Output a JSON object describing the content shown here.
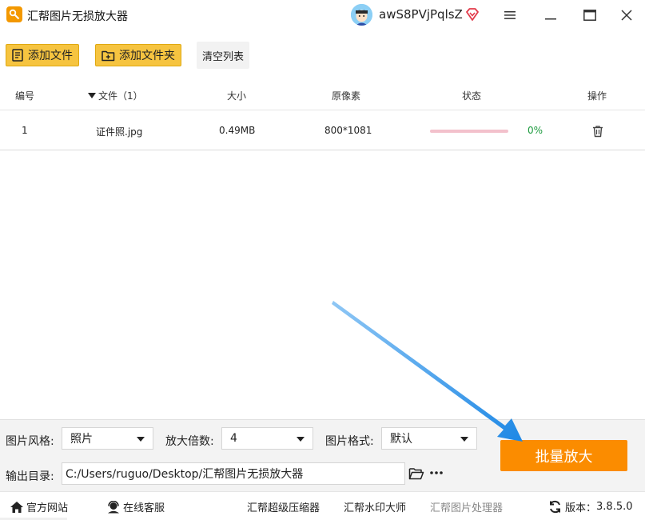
{
  "window": {
    "title": "汇帮图片无损放大器",
    "username": "awS8PVjPqlsZ"
  },
  "toolbar": {
    "add_file": "添加文件",
    "add_folder": "添加文件夹",
    "clear_list": "清空列表"
  },
  "table": {
    "headers": {
      "index": "编号",
      "file": "文件（1）",
      "size": "大小",
      "pixels": "原像素",
      "status": "状态",
      "action": "操作"
    },
    "rows": [
      {
        "index": "1",
        "file": "证件照.jpg",
        "size": "0.49MB",
        "pixels": "800*1081",
        "progress": 0,
        "percent": "0%"
      }
    ]
  },
  "settings": {
    "style_label": "图片风格:",
    "style_value": "照片",
    "scale_label": "放大倍数:",
    "scale_value": "4",
    "format_label": "图片格式:",
    "format_value": "默认",
    "output_label": "输出目录:",
    "output_path": "C:/Users/ruguo/Desktop/汇帮图片无损放大器",
    "more": "···",
    "batch_button": "批量放大"
  },
  "footer": {
    "website": "官方网站",
    "support": "在线客服",
    "compressor": "汇帮超级压缩器",
    "watermark": "汇帮水印大师",
    "processor": "汇帮图片处理器",
    "version_label": "版本：",
    "version": "3.8.5.0"
  },
  "colors": {
    "accent_orange": "#fb8c00",
    "button_yellow": "#f6c440",
    "progress_pink": "#f3c1cc",
    "percent_green": "#1a9a3c",
    "arrow_blue": "#1e88e5"
  }
}
